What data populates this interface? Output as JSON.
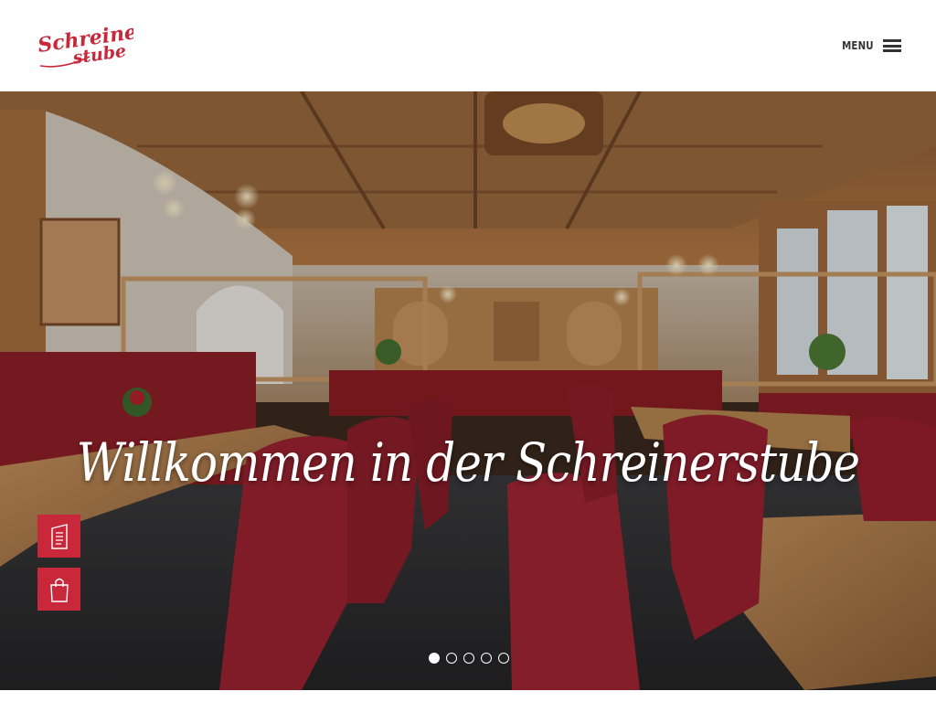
{
  "header": {
    "logo_line1": "Schreiner",
    "logo_line2": "stube",
    "menu_label": "MENU"
  },
  "hero": {
    "title": "Willkommen in der Schreinerstube",
    "slides": {
      "count": 5,
      "active_index": 0
    }
  },
  "side_actions": [
    {
      "name": "menu-card",
      "icon": "menu-card-icon"
    },
    {
      "name": "shop",
      "icon": "shopping-bag-icon"
    }
  ],
  "colors": {
    "brand_red": "#c8283a",
    "menu_text": "#333333",
    "header_bg": "#ffffff"
  }
}
